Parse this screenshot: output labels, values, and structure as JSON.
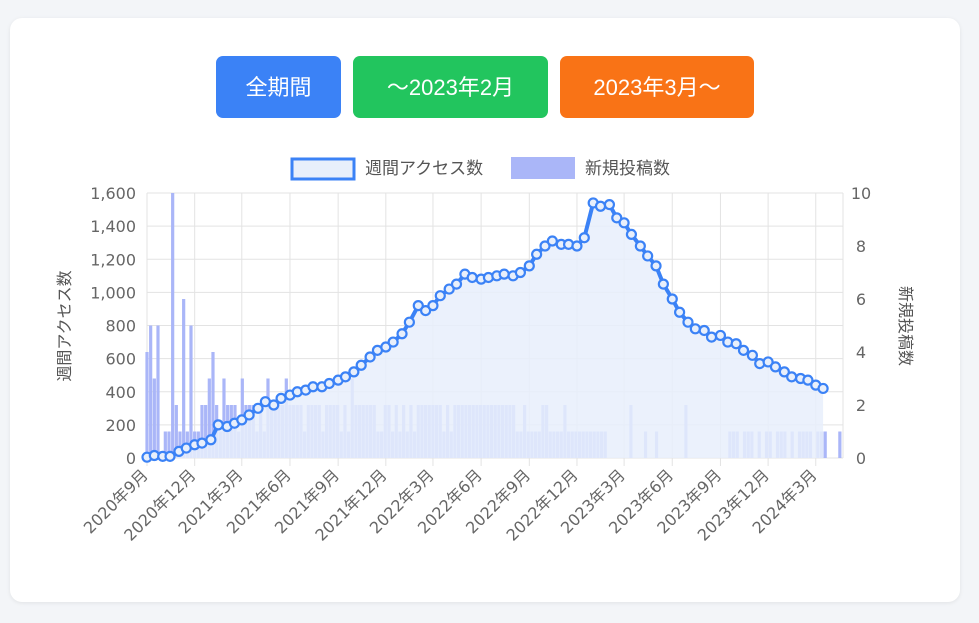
{
  "buttons": {
    "all": "全期間",
    "until": "〜2023年2月",
    "from": "2023年3月〜"
  },
  "colors": {
    "line": "#3b82f6",
    "line_fill": "#e8effb",
    "bars": "#aab6f8",
    "grid": "#e3e3e3"
  },
  "chart_data": {
    "type": "bar+line",
    "legend": {
      "position": "top",
      "entries": [
        "週間アクセス数",
        "新規投稿数"
      ]
    },
    "y_left": {
      "label": "週間アクセス数",
      "min": 0,
      "max": 1600,
      "ticks": [
        "0",
        "200",
        "400",
        "600",
        "800",
        "1,000",
        "1,200",
        "1,400",
        "1,600"
      ]
    },
    "y_right": {
      "label": "新規投稿数",
      "min": 0,
      "max": 10,
      "ticks": [
        "0",
        "2",
        "4",
        "6",
        "8",
        "10"
      ]
    },
    "x_tick_labels": [
      "2020年9月",
      "2020年12月",
      "2021年3月",
      "2021年6月",
      "2021年9月",
      "2021年12月",
      "2022年3月",
      "2022年6月",
      "2022年9月",
      "2022年12月",
      "2023年3月",
      "2023年6月",
      "2023年9月",
      "2023年12月",
      "2024年3月"
    ],
    "x_range": [
      "2020-09-01",
      "2024-04-22"
    ],
    "grid": true,
    "series": [
      {
        "name": "週間アクセス数",
        "kind": "line",
        "axis": "left",
        "points": [
          [
            "2020-09-01",
            5
          ],
          [
            "2020-09-15",
            15
          ],
          [
            "2020-10-01",
            10
          ],
          [
            "2020-10-15",
            10
          ],
          [
            "2020-11-01",
            40
          ],
          [
            "2020-11-15",
            60
          ],
          [
            "2020-12-01",
            80
          ],
          [
            "2020-12-15",
            90
          ],
          [
            "2021-01-01",
            110
          ],
          [
            "2021-01-15",
            200
          ],
          [
            "2021-02-01",
            190
          ],
          [
            "2021-02-15",
            210
          ],
          [
            "2021-03-01",
            230
          ],
          [
            "2021-03-15",
            260
          ],
          [
            "2021-04-01",
            300
          ],
          [
            "2021-04-15",
            340
          ],
          [
            "2021-05-01",
            320
          ],
          [
            "2021-05-15",
            360
          ],
          [
            "2021-06-01",
            380
          ],
          [
            "2021-06-15",
            400
          ],
          [
            "2021-07-01",
            410
          ],
          [
            "2021-07-15",
            430
          ],
          [
            "2021-08-01",
            430
          ],
          [
            "2021-08-15",
            450
          ],
          [
            "2021-09-01",
            470
          ],
          [
            "2021-09-15",
            490
          ],
          [
            "2021-10-01",
            520
          ],
          [
            "2021-10-15",
            560
          ],
          [
            "2021-11-01",
            610
          ],
          [
            "2021-11-15",
            650
          ],
          [
            "2021-12-01",
            670
          ],
          [
            "2021-12-15",
            700
          ],
          [
            "2022-01-01",
            750
          ],
          [
            "2022-01-15",
            820
          ],
          [
            "2022-02-01",
            920
          ],
          [
            "2022-02-15",
            890
          ],
          [
            "2022-03-01",
            920
          ],
          [
            "2022-03-15",
            980
          ],
          [
            "2022-04-01",
            1020
          ],
          [
            "2022-04-15",
            1050
          ],
          [
            "2022-05-01",
            1110
          ],
          [
            "2022-05-15",
            1090
          ],
          [
            "2022-06-01",
            1080
          ],
          [
            "2022-06-15",
            1090
          ],
          [
            "2022-07-01",
            1100
          ],
          [
            "2022-07-15",
            1110
          ],
          [
            "2022-08-01",
            1100
          ],
          [
            "2022-08-15",
            1120
          ],
          [
            "2022-09-01",
            1160
          ],
          [
            "2022-09-15",
            1230
          ],
          [
            "2022-10-01",
            1280
          ],
          [
            "2022-10-15",
            1310
          ],
          [
            "2022-11-01",
            1290
          ],
          [
            "2022-11-15",
            1290
          ],
          [
            "2022-12-01",
            1280
          ],
          [
            "2022-12-15",
            1330
          ],
          [
            "2023-01-01",
            1540
          ],
          [
            "2023-01-15",
            1520
          ],
          [
            "2023-02-01",
            1530
          ],
          [
            "2023-02-15",
            1450
          ],
          [
            "2023-03-01",
            1420
          ],
          [
            "2023-03-15",
            1350
          ],
          [
            "2023-04-01",
            1280
          ],
          [
            "2023-04-15",
            1220
          ],
          [
            "2023-05-01",
            1160
          ],
          [
            "2023-05-15",
            1050
          ],
          [
            "2023-06-01",
            960
          ],
          [
            "2023-06-15",
            880
          ],
          [
            "2023-07-01",
            820
          ],
          [
            "2023-07-15",
            780
          ],
          [
            "2023-08-01",
            770
          ],
          [
            "2023-08-15",
            730
          ],
          [
            "2023-09-01",
            740
          ],
          [
            "2023-09-15",
            700
          ],
          [
            "2023-10-01",
            690
          ],
          [
            "2023-10-15",
            650
          ],
          [
            "2023-11-01",
            620
          ],
          [
            "2023-11-15",
            570
          ],
          [
            "2023-12-01",
            580
          ],
          [
            "2023-12-15",
            550
          ],
          [
            "2024-01-01",
            520
          ],
          [
            "2024-01-15",
            490
          ],
          [
            "2024-02-01",
            480
          ],
          [
            "2024-02-15",
            470
          ],
          [
            "2024-03-01",
            440
          ],
          [
            "2024-03-15",
            420
          ]
        ]
      },
      {
        "name": "新規投稿数",
        "kind": "bar",
        "axis": "right",
        "points": [
          [
            "2020-09-01",
            4
          ],
          [
            "2020-09-08",
            5
          ],
          [
            "2020-09-15",
            3
          ],
          [
            "2020-09-22",
            5
          ],
          [
            "2020-10-06",
            1
          ],
          [
            "2020-10-13",
            1
          ],
          [
            "2020-10-20",
            10
          ],
          [
            "2020-10-27",
            2
          ],
          [
            "2020-11-03",
            1
          ],
          [
            "2020-11-10",
            6
          ],
          [
            "2020-11-17",
            1
          ],
          [
            "2020-11-24",
            5
          ],
          [
            "2020-12-01",
            1
          ],
          [
            "2020-12-08",
            1
          ],
          [
            "2020-12-15",
            2
          ],
          [
            "2020-12-22",
            2
          ],
          [
            "2020-12-29",
            3
          ],
          [
            "2021-01-05",
            4
          ],
          [
            "2021-01-12",
            2
          ],
          [
            "2021-01-19",
            1
          ],
          [
            "2021-01-26",
            3
          ],
          [
            "2021-02-02",
            2
          ],
          [
            "2021-02-09",
            2
          ],
          [
            "2021-02-16",
            2
          ],
          [
            "2021-02-23",
            1
          ],
          [
            "2021-03-02",
            3
          ],
          [
            "2021-03-09",
            2
          ],
          [
            "2021-03-16",
            2
          ],
          [
            "2021-03-23",
            2
          ],
          [
            "2021-03-30",
            1
          ],
          [
            "2021-04-06",
            2
          ],
          [
            "2021-04-13",
            1
          ],
          [
            "2021-04-20",
            3
          ],
          [
            "2021-04-27",
            2
          ],
          [
            "2021-05-04",
            2
          ],
          [
            "2021-05-11",
            2
          ],
          [
            "2021-05-18",
            2
          ],
          [
            "2021-05-25",
            3
          ],
          [
            "2021-06-01",
            2
          ],
          [
            "2021-06-08",
            2
          ],
          [
            "2021-06-15",
            2
          ],
          [
            "2021-06-22",
            2
          ],
          [
            "2021-06-29",
            1
          ],
          [
            "2021-07-06",
            2
          ],
          [
            "2021-07-13",
            2
          ],
          [
            "2021-07-20",
            2
          ],
          [
            "2021-07-27",
            2
          ],
          [
            "2021-08-03",
            1
          ],
          [
            "2021-08-10",
            2
          ],
          [
            "2021-08-17",
            2
          ],
          [
            "2021-08-24",
            2
          ],
          [
            "2021-08-31",
            2
          ],
          [
            "2021-09-07",
            1
          ],
          [
            "2021-09-14",
            2
          ],
          [
            "2021-09-21",
            1
          ],
          [
            "2021-09-28",
            3
          ],
          [
            "2021-10-05",
            2
          ],
          [
            "2021-10-12",
            2
          ],
          [
            "2021-10-19",
            2
          ],
          [
            "2021-10-26",
            2
          ],
          [
            "2021-11-02",
            2
          ],
          [
            "2021-11-09",
            2
          ],
          [
            "2021-11-16",
            1
          ],
          [
            "2021-11-23",
            1
          ],
          [
            "2021-11-30",
            2
          ],
          [
            "2021-12-07",
            2
          ],
          [
            "2021-12-14",
            1
          ],
          [
            "2021-12-21",
            2
          ],
          [
            "2021-12-28",
            1
          ],
          [
            "2022-01-04",
            2
          ],
          [
            "2022-01-11",
            1
          ],
          [
            "2022-01-18",
            2
          ],
          [
            "2022-01-25",
            1
          ],
          [
            "2022-02-01",
            2
          ],
          [
            "2022-02-08",
            2
          ],
          [
            "2022-02-15",
            2
          ],
          [
            "2022-02-22",
            2
          ],
          [
            "2022-03-01",
            2
          ],
          [
            "2022-03-08",
            2
          ],
          [
            "2022-03-15",
            2
          ],
          [
            "2022-03-22",
            1
          ],
          [
            "2022-03-29",
            2
          ],
          [
            "2022-04-05",
            1
          ],
          [
            "2022-04-12",
            2
          ],
          [
            "2022-04-19",
            2
          ],
          [
            "2022-04-26",
            2
          ],
          [
            "2022-05-03",
            2
          ],
          [
            "2022-05-10",
            2
          ],
          [
            "2022-05-17",
            2
          ],
          [
            "2022-05-24",
            2
          ],
          [
            "2022-05-31",
            2
          ],
          [
            "2022-06-07",
            2
          ],
          [
            "2022-06-14",
            2
          ],
          [
            "2022-06-21",
            2
          ],
          [
            "2022-06-28",
            2
          ],
          [
            "2022-07-05",
            2
          ],
          [
            "2022-07-12",
            2
          ],
          [
            "2022-07-19",
            2
          ],
          [
            "2022-07-26",
            2
          ],
          [
            "2022-08-02",
            2
          ],
          [
            "2022-08-09",
            1
          ],
          [
            "2022-08-16",
            1
          ],
          [
            "2022-08-23",
            2
          ],
          [
            "2022-08-30",
            1
          ],
          [
            "2022-09-06",
            1
          ],
          [
            "2022-09-13",
            1
          ],
          [
            "2022-09-20",
            1
          ],
          [
            "2022-09-27",
            2
          ],
          [
            "2022-10-04",
            2
          ],
          [
            "2022-10-11",
            1
          ],
          [
            "2022-10-18",
            1
          ],
          [
            "2022-10-25",
            1
          ],
          [
            "2022-11-01",
            1
          ],
          [
            "2022-11-08",
            2
          ],
          [
            "2022-11-15",
            1
          ],
          [
            "2022-11-22",
            1
          ],
          [
            "2022-11-29",
            1
          ],
          [
            "2022-12-06",
            1
          ],
          [
            "2022-12-13",
            1
          ],
          [
            "2022-12-20",
            1
          ],
          [
            "2022-12-27",
            1
          ],
          [
            "2023-01-03",
            1
          ],
          [
            "2023-01-10",
            1
          ],
          [
            "2023-01-17",
            1
          ],
          [
            "2023-01-24",
            1
          ],
          [
            "2023-03-14",
            2
          ],
          [
            "2023-04-11",
            1
          ],
          [
            "2023-05-02",
            1
          ],
          [
            "2023-06-27",
            2
          ],
          [
            "2023-09-19",
            1
          ],
          [
            "2023-09-26",
            1
          ],
          [
            "2023-10-03",
            1
          ],
          [
            "2023-10-17",
            1
          ],
          [
            "2023-10-24",
            1
          ],
          [
            "2023-10-31",
            1
          ],
          [
            "2023-11-14",
            1
          ],
          [
            "2023-11-28",
            1
          ],
          [
            "2023-12-05",
            1
          ],
          [
            "2023-12-19",
            1
          ],
          [
            "2023-12-26",
            1
          ],
          [
            "2024-01-02",
            1
          ],
          [
            "2024-01-16",
            1
          ],
          [
            "2024-01-30",
            1
          ],
          [
            "2024-02-06",
            1
          ],
          [
            "2024-02-13",
            1
          ],
          [
            "2024-02-20",
            1
          ],
          [
            "2024-03-05",
            1
          ],
          [
            "2024-03-12",
            1
          ],
          [
            "2024-03-19",
            1
          ],
          [
            "2024-04-16",
            1
          ]
        ]
      }
    ]
  }
}
